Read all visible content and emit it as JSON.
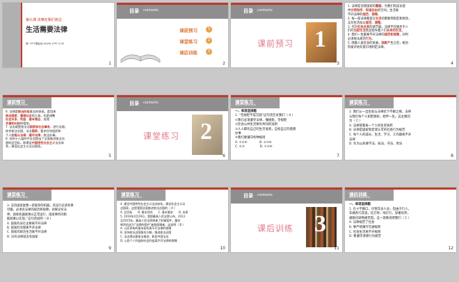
{
  "slides": [
    {
      "n": "1",
      "lesson": "第九课 法律在我们身边",
      "title": "生活需要法律",
      "footer": "第一PPT模板网-WWW.1PPT.COM"
    },
    {
      "n": "2",
      "head": "目录",
      "head_en": "contents",
      "items": [
        "课前预习",
        "课堂练习",
        "课后训练"
      ],
      "badges": [
        "1",
        "2",
        "3"
      ]
    },
    {
      "n": "3",
      "head": "目录",
      "head_en": "contents",
      "section": "课前预习",
      "bignum": "1"
    },
    {
      "n": "4",
      "lines": [
        "1. 法律是治理国家的",
        "重器",
        "，为我们的成长提",
        "供",
        "文明有序",
        "、",
        "和谐自由",
        "的空间。生活离",
        "不开法律的",
        "规范",
        "、",
        "保障",
        "。",
        "2. 每一部法律都是在",
        "生活",
        "的需要而制定和修改，",
        "又对生活加以",
        "规范",
        "、",
        "调整",
        "。",
        "3. 作为",
        "社会关系",
        "的调节器，法律不仅服务于人",
        "们的",
        "当前生活",
        "而且指导着人们",
        "未来的生活",
        "。",
        "4. 我们一生都离不开法律的",
        "规范和保障",
        "，同时",
        "必须依法规范",
        "行为",
        "。",
        "5. 随着人类社会的发展，",
        "国家",
        "产生之后，统治",
        "阶级开始有意识地制定法律。"
      ]
    },
    {
      "n": "5",
      "sec": "课前预习",
      "sec_en": "Work materials",
      "lines": [
        "6. 法律是",
        "统治阶级",
        "意志的体现，是用来",
        "统治国家",
        "、",
        "管理社会",
        "的工具，也是调整",
        "社会关系",
        "、",
        "利益",
        "、",
        "基本商品",
        "、处理",
        "矛盾和纠纷",
        "的相关。",
        "7. 法治就是依法治",
        "国家和社会事务",
        "，进行治理，",
        "综合依法治国、法治",
        "国家",
        "。要求任何组织和",
        "个人都",
        "服从法律",
        "、",
        "遵守法律",
        "，依法办事。",
        "8. 党的十八届四中全会提出了全面推进依法治",
        "国的总目标，即建设",
        "中国特色社会主义",
        "法治体",
        "系，建设社会主义法治国家。"
      ]
    },
    {
      "n": "6",
      "head": "目录",
      "head_en": "contents",
      "section": "课堂练习",
      "bignum": "2"
    },
    {
      "n": "7",
      "sec": "课堂练习",
      "sec_en": "Work materials",
      "lines": [
        "一、单项选择题",
        "1. “无规矩不成方圆”这句话告诉我们（ A ）",
        "①我们必须遵守法律，懂规矩，守规矩",
        "②社会公共生活要有共同的准则",
        "③人人都有自己的生活准则，应按自己的意愿",
        "办事",
        "④我们要遵守各种规则",
        "A. ①②④　　　　B. ②③④",
        "C. ①③　　　　　D. ①③④"
      ]
    },
    {
      "n": "8",
      "sec": "课堂练习",
      "sec_en": "Work materials",
      "lines": [
        "2. 我们从一出生就与法律结下不解之缘，法律",
        "与我们每个人如影随形，相伴一生。这主要因",
        "为（ C ）",
        "A. 法律管着每一个人的生老病死",
        "B. 法律是国家制定或认可的社会行为规范",
        "C. 每个人的成长、生活、学习、工作都离不开",
        "法律",
        "D. 作为公民要学法、知法、守法、用法"
      ]
    },
    {
      "n": "9",
      "sec": "课堂练习",
      "sec_en": "Work materials",
      "lines": [
        "3. 法治国家就像一部复杂的机器，其运行必须有章",
        "可循。必须有法律的规范和保障，如果没有法",
        "律，国家机器就难以正常运行，国家事务的职",
        "能就难以实现。”这句话说明（ B ）",
        "A. 国家的法在主要离不开法律",
        "B. 国家的治理离不开法律",
        "C. 国家的政治生活离不开法律",
        "D. 没有法律就没有国家"
      ]
    },
    {
      "n": "10",
      "sec": "课堂练习",
      "sec_en": "Work materials",
      "lines": [
        "4. 建设中国特色社会主义法治体系，建设社会主义法",
        "治国家，这是我国全面推进依法治国的（ A ）",
        "A. 总目标　　B. 根本目的　　C. 基本要求　　D. 本质",
        "5. 2016年2月29日，我国最高人民法院公布，2013",
        "至2015年，最高人民法院审查了刑事案件，重申",
        "审判机关为“法律的保护”者和保障者，这说明（ B ）",
        "A. 公民享有的基本权利离不开法律的保障",
        "B. 坚持依法治国基本方略，推进依法治国",
        "C. 法治理论要依法推进，彰显中国法治",
        "D. 公民个人利益和社会利益离不开法律的保障"
      ]
    },
    {
      "n": "11",
      "head": "目录",
      "head_en": "contents",
      "section": "课后训练",
      "bignum": "3"
    },
    {
      "n": "12",
      "sec": "课后训练",
      "sec_en": "Work materials",
      "lines": [
        "一、单项选择题",
        "1. 在十字路口，尽管车多人多，但由于行人，",
        "车辆各行其道，红灯停、绿灯行，穿梭有序，",
        "通服也就畅通无阻。这一现象说明我们（ C ）",
        "A. 法律规范了社会",
        "B. 要严格遵守交通规则",
        "C. 社会生活离不开规则",
        "D. 要遵守道德行为规范"
      ]
    }
  ],
  "colors": {
    "red": "#c0392b",
    "gray": "#8e8e8e",
    "orange": "#e07a3a",
    "pink": "#e07a8a"
  }
}
